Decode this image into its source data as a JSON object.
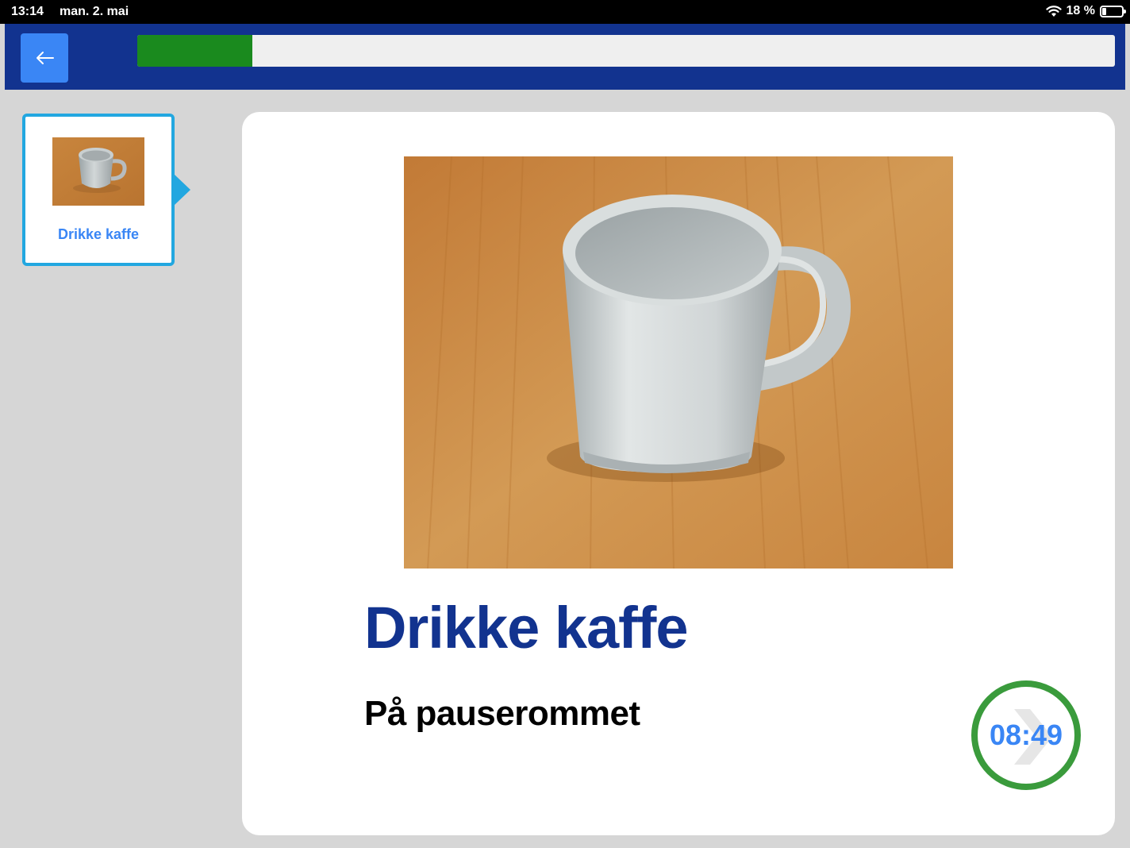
{
  "status_bar": {
    "time": "13:14",
    "date": "man. 2. mai",
    "battery_text": "18 %",
    "battery_level": 0.18
  },
  "toolbar": {
    "progress_fraction": 0.118,
    "progress_color": "#1a8a1e",
    "accent": "#3a86f5"
  },
  "steps": [
    {
      "label": "Drikke kaffe",
      "selected": true
    }
  ],
  "activity": {
    "title": "Drikke kaffe",
    "subtitle": "På pauserommet",
    "timer": "08:49"
  }
}
